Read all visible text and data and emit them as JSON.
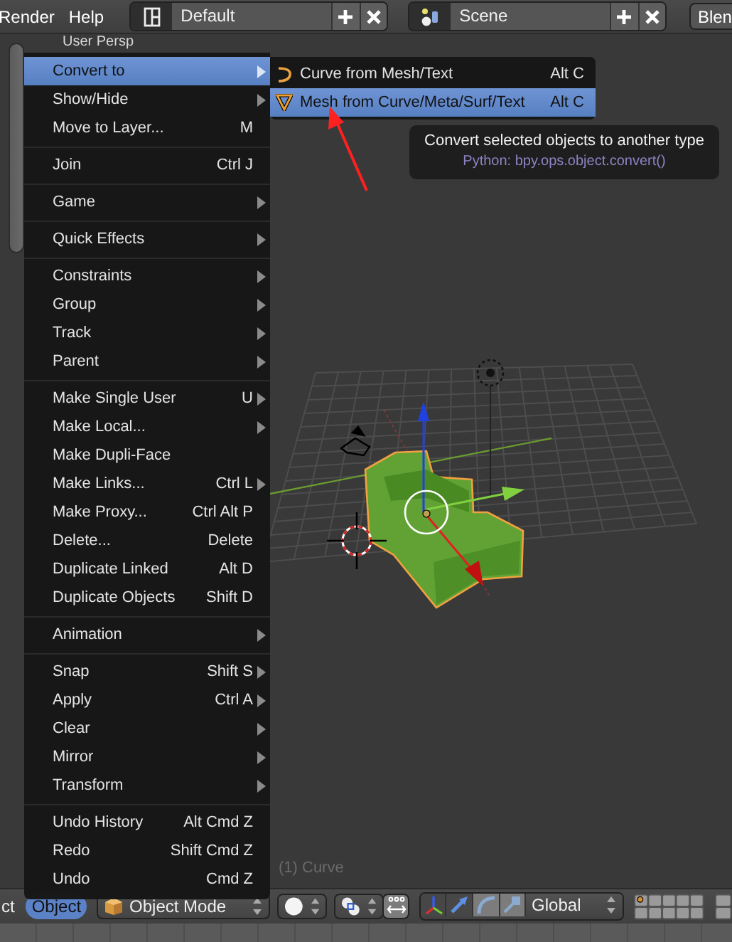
{
  "top_bar": {
    "menus": [
      {
        "label": "Render"
      },
      {
        "label": "Help"
      }
    ],
    "screen_layout": {
      "value": "Default"
    },
    "scene": {
      "value": "Scene"
    },
    "engine": {
      "value": "Blen"
    }
  },
  "viewport": {
    "view_label": "User Persp",
    "object_label": "(1) Curve"
  },
  "menu": {
    "sections": [
      [
        {
          "label": "Convert to",
          "submenu": true,
          "selected": true
        },
        {
          "label": "Show/Hide",
          "submenu": true,
          "selected": false
        },
        {
          "label": "Move to Layer...",
          "shortcut": "M",
          "submenu": false,
          "selected": false
        }
      ],
      [
        {
          "label": "Join",
          "shortcut": "Ctrl J",
          "submenu": false,
          "selected": false
        }
      ],
      [
        {
          "label": "Game",
          "submenu": true,
          "selected": false
        }
      ],
      [
        {
          "label": "Quick Effects",
          "submenu": true,
          "selected": false
        }
      ],
      [
        {
          "label": "Constraints",
          "submenu": true,
          "selected": false
        },
        {
          "label": "Group",
          "submenu": true,
          "selected": false
        },
        {
          "label": "Track",
          "submenu": true,
          "selected": false
        },
        {
          "label": "Parent",
          "submenu": true,
          "selected": false
        }
      ],
      [
        {
          "label": "Make Single User",
          "shortcut": "U",
          "submenu": true,
          "selected": false
        },
        {
          "label": "Make Local...",
          "submenu": true,
          "selected": false
        },
        {
          "label": "Make Dupli-Face",
          "submenu": false,
          "selected": false
        },
        {
          "label": "Make Links...",
          "shortcut": "Ctrl L",
          "submenu": true,
          "selected": false
        },
        {
          "label": "Make Proxy...",
          "shortcut": "Ctrl Alt P",
          "submenu": false,
          "selected": false
        },
        {
          "label": "Delete...",
          "shortcut": "Delete",
          "submenu": false,
          "selected": false
        },
        {
          "label": "Duplicate Linked",
          "shortcut": "Alt D",
          "submenu": false,
          "selected": false
        },
        {
          "label": "Duplicate Objects",
          "shortcut": "Shift D",
          "submenu": false,
          "selected": false
        }
      ],
      [
        {
          "label": "Animation",
          "submenu": true,
          "selected": false
        }
      ],
      [
        {
          "label": "Snap",
          "shortcut": "Shift S",
          "submenu": true,
          "selected": false
        },
        {
          "label": "Apply",
          "shortcut": "Ctrl A",
          "submenu": true,
          "selected": false
        },
        {
          "label": "Clear",
          "submenu": true,
          "selected": false
        },
        {
          "label": "Mirror",
          "submenu": true,
          "selected": false
        },
        {
          "label": "Transform",
          "submenu": true,
          "selected": false
        }
      ],
      [
        {
          "label": "Undo History",
          "shortcut": "Alt Cmd Z",
          "submenu": false,
          "selected": false
        },
        {
          "label": "Redo",
          "shortcut": "Shift Cmd Z",
          "submenu": false,
          "selected": false
        },
        {
          "label": "Undo",
          "shortcut": "Cmd Z",
          "submenu": false,
          "selected": false
        }
      ]
    ]
  },
  "submenu": {
    "items": [
      {
        "kind": "curve",
        "label": "Curve from Mesh/Text",
        "shortcut": "Alt C",
        "selected": false
      },
      {
        "kind": "mesh",
        "label": "Mesh from Curve/Meta/Surf/Text",
        "shortcut": "Alt C",
        "selected": true
      }
    ]
  },
  "tooltip": {
    "title": "Convert selected objects to another type",
    "python": "Python: bpy.ops.object.convert()"
  },
  "bottom_bar": {
    "menus": [
      {
        "label": "ct",
        "selected": false
      },
      {
        "label": "Object",
        "selected": true
      }
    ],
    "mode": {
      "value": "Object Mode"
    },
    "orientation": {
      "value": "Global"
    }
  }
}
